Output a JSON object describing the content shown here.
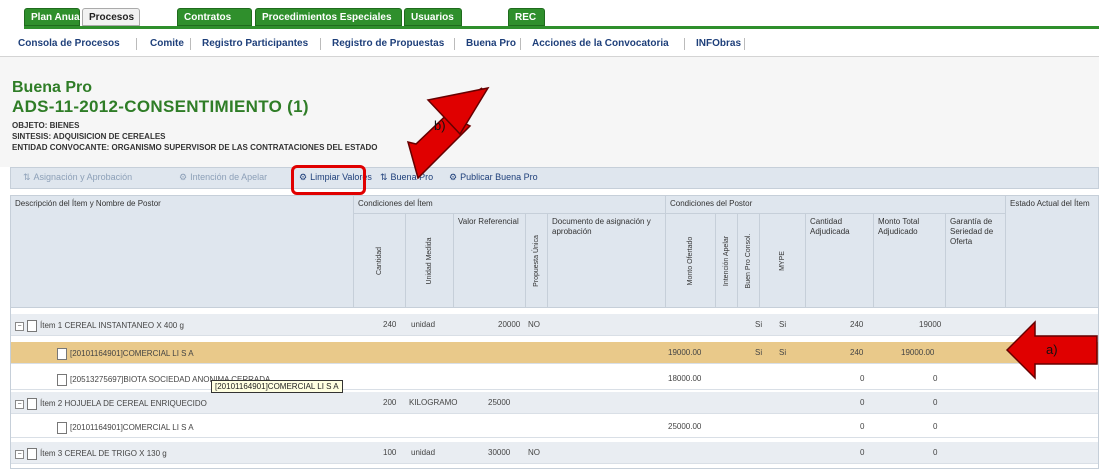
{
  "top_tabs": [
    "Plan Anual",
    "Procesos",
    "Contratos",
    "Procedimientos Especiales",
    "Usuarios",
    "REC"
  ],
  "top_tabs_active": "Procesos",
  "sub_tabs": [
    "Consola de Procesos",
    "Comite",
    "Registro Participantes",
    "Registro de Propuestas",
    "Buena Pro",
    "Acciones de la Convocatoria",
    "INFObras"
  ],
  "header": {
    "title": "Buena Pro",
    "process_id": "ADS-11-2012-CONSENTIMIENTO (1)",
    "objeto": "OBJETO: BIENES",
    "sintesis": "SINTESIS: ADQUISICION DE CEREALES",
    "entidad": "ENTIDAD CONVOCANTE: ORGANISMO SUPERVISOR DE LAS CONTRATACIONES DEL ESTADO"
  },
  "toolbar": {
    "asignacion": "Asignación y Aprobación",
    "intencion": "Intención de Apelar",
    "limpiar": "Limpiar Valores",
    "buena_pro": "Buena Pro",
    "publicar": "Publicar Buena Pro"
  },
  "grid": {
    "col_descripcion": "Descripción del Ítem y Nombre de Postor",
    "group_item": "Condiciones del Ítem",
    "group_postor": "Condiciones del Postor",
    "col_estado": "Estado Actual del Ítem",
    "col_cantidad": "Cantidad",
    "col_unidad": "Unidad Medida",
    "col_valor": "Valor Referencial",
    "col_propuesta": "Propuesta Única",
    "col_documento": "Documento de asignación y aprobación",
    "col_monto_ofertado": "Monto Ofertado",
    "col_intencion": "Intención Apelar",
    "col_buena_pro": "Buen Pro Consol.",
    "col_mype": "MYPE",
    "col_cantidad_adj": "Cantidad Adjudicada",
    "col_monto_total": "Monto Total Adjudicado",
    "col_garantia": "Garantía de Seriedad de Oferta",
    "rows": [
      {
        "kind": "item",
        "label": "Ítem 1 CEREAL INSTANTANEO X 400 g",
        "cantidad": "240",
        "unidad": "unidad",
        "valor": "20000",
        "propuesta": "NO",
        "monto": "",
        "intencion": "",
        "bp": "Si",
        "mype": "Si",
        "cant_adj": "240",
        "monto_adj": "19000"
      },
      {
        "kind": "postor-selected",
        "label": "[20101164901]COMERCIAL LI S A",
        "cantidad": "",
        "unidad": "",
        "valor": "",
        "propuesta": "",
        "monto": "19000.00",
        "intencion": "",
        "bp": "Si",
        "mype": "Si",
        "cant_adj": "240",
        "monto_adj": "19000.00"
      },
      {
        "kind": "postor",
        "label": "[20513275697]BIOTA SOCIEDAD ANONIMA CERRADA",
        "cantidad": "",
        "unidad": "",
        "valor": "",
        "propuesta": "",
        "monto": "18000.00",
        "intencion": "",
        "bp": "",
        "mype": "",
        "cant_adj": "0",
        "monto_adj": "0"
      },
      {
        "kind": "item",
        "label": "Ítem 2 HOJUELA DE CEREAL ENRIQUECIDO",
        "cantidad": "200",
        "unidad": "KILOGRAMO",
        "valor": "25000",
        "propuesta": "",
        "monto": "",
        "intencion": "",
        "bp": "",
        "mype": "",
        "cant_adj": "0",
        "monto_adj": "0"
      },
      {
        "kind": "postor",
        "label": "[20101164901]COMERCIAL LI S A",
        "cantidad": "",
        "unidad": "",
        "valor": "",
        "propuesta": "",
        "monto": "25000.00",
        "intencion": "",
        "bp": "",
        "mype": "",
        "cant_adj": "0",
        "monto_adj": "0"
      },
      {
        "kind": "item",
        "label": "Ítem 3 CEREAL DE TRIGO X 130 g",
        "cantidad": "100",
        "unidad": "unidad",
        "valor": "30000",
        "propuesta": "NO",
        "monto": "",
        "intencion": "",
        "bp": "",
        "mype": "",
        "cant_adj": "0",
        "monto_adj": "0"
      }
    ]
  },
  "tooltip": "[20101164901]COMERCIAL LI S A",
  "annotations": {
    "a": "a)",
    "b": "b)"
  },
  "colors": {
    "accent_green": "#2f8f2c",
    "title_green": "#2f7d27",
    "highlight_row": "#e9c98a",
    "annotation_red": "#e00000"
  }
}
